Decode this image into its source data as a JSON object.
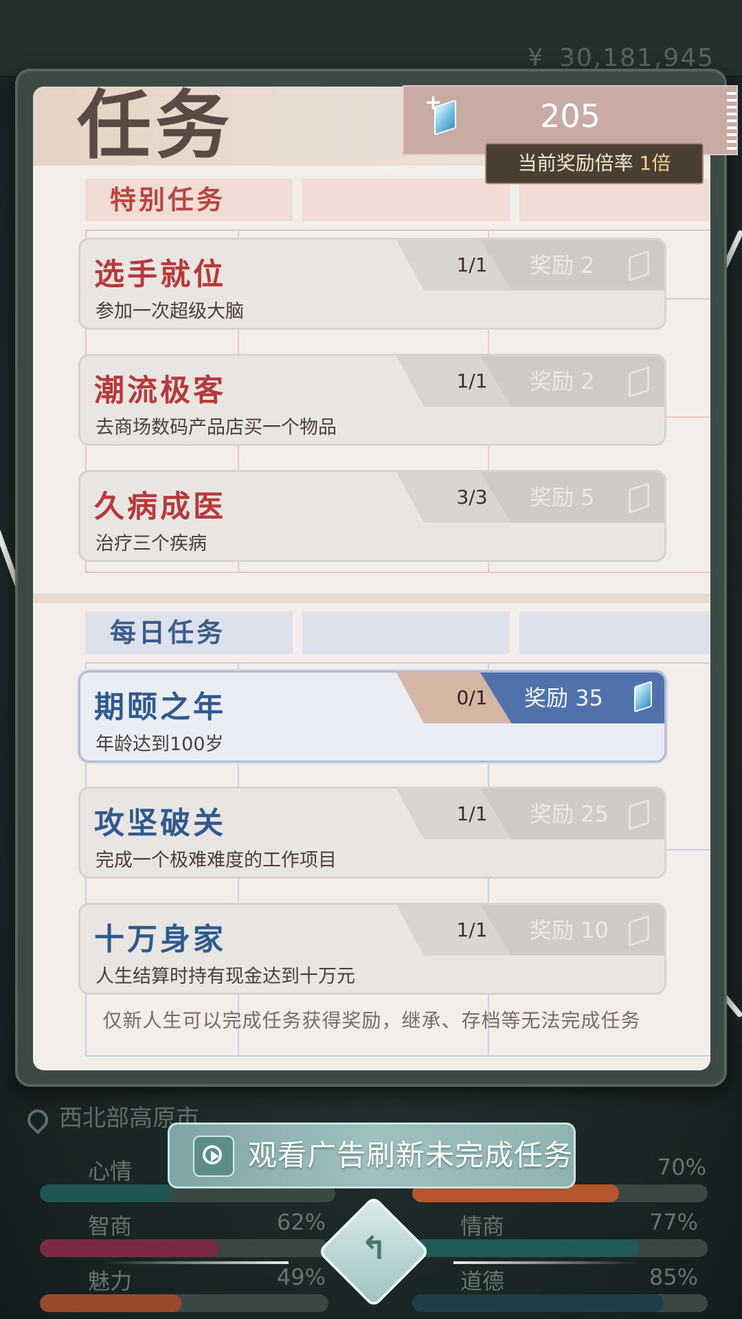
{
  "background": {
    "currency_symbol": "¥",
    "money": "30,181,945"
  },
  "panel": {
    "title": "任务",
    "gems": "205",
    "gem_plus": "+",
    "rate_prefix": "当前奖励倍率",
    "rate_value": "1倍"
  },
  "special": {
    "header": "特别任务",
    "tasks": [
      {
        "name": "选手就位",
        "desc": "参加一次超级大脑",
        "progress": "1/1",
        "reward": "奖励 2"
      },
      {
        "name": "潮流极客",
        "desc": "去商场数码产品店买一个物品",
        "progress": "1/1",
        "reward": "奖励 2"
      },
      {
        "name": "久病成医",
        "desc": "治疗三个疾病",
        "progress": "3/3",
        "reward": "奖励 5"
      }
    ]
  },
  "daily": {
    "header": "每日任务",
    "tasks": [
      {
        "name": "期颐之年",
        "desc": "年龄达到100岁",
        "progress": "0/1",
        "reward": "奖励 35"
      },
      {
        "name": "攻坚破关",
        "desc": "完成一个极难难度的工作项目",
        "progress": "1/1",
        "reward": "奖励 25"
      },
      {
        "name": "十万身家",
        "desc": "人生结算时持有现金达到十万元",
        "progress": "1/1",
        "reward": "奖励 10"
      }
    ]
  },
  "footnote": "仅新人生可以完成任务获得奖励，继承、存档等无法完成任务",
  "location": "西北部高原市",
  "stats": {
    "mood": {
      "label": "心情",
      "pct": "70%",
      "left_value": 0.45,
      "value": 0.7,
      "color": "#b5562e"
    },
    "iq": {
      "label": "智商",
      "pct": "62%",
      "value": 0.62,
      "color": "#7a2a45"
    },
    "eq": {
      "label": "情商",
      "pct": "77%",
      "value": 0.77,
      "color": "#1f5a57"
    },
    "charm": {
      "label": "魅力",
      "pct": "49%",
      "value": 0.49,
      "color": "#9a4a2a"
    },
    "morality": {
      "label": "道德",
      "pct": "85%",
      "value": 0.85,
      "color": "#1b3e48"
    }
  },
  "ad_button": {
    "label": "观看广告刷新未完成任务",
    "icon": "replay-ad-icon"
  },
  "back_button": {
    "icon": "back-arrow-icon",
    "glyph": "↰"
  },
  "colors": {
    "special_accent": "#b7393a",
    "daily_accent": "#2f5a8e",
    "reward_active": "#4f72ad"
  }
}
